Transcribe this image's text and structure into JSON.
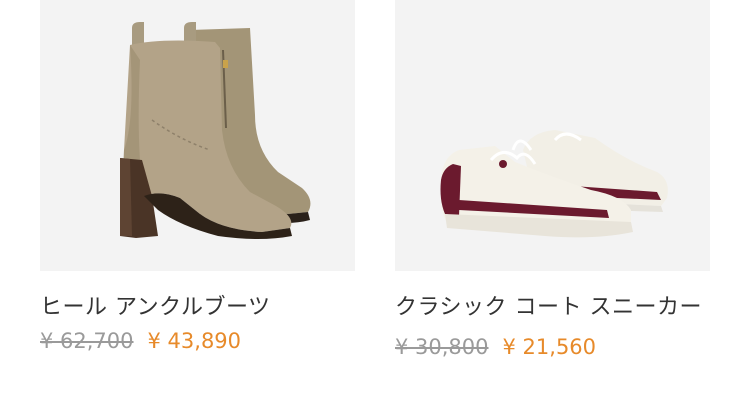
{
  "products": [
    {
      "name": "ヒール アンクルブーツ",
      "original_price": "¥ 62,700",
      "sale_price": "¥ 43,890",
      "image_icon": "ankle-boot-icon"
    },
    {
      "name": "クラシック コート スニーカー",
      "original_price": "¥ 30,800",
      "sale_price": "¥ 21,560",
      "image_icon": "sneaker-icon"
    }
  ],
  "colors": {
    "sale_price": "#e78a2a",
    "original_price": "#9a9a9a",
    "image_background": "#f3f3f3"
  }
}
